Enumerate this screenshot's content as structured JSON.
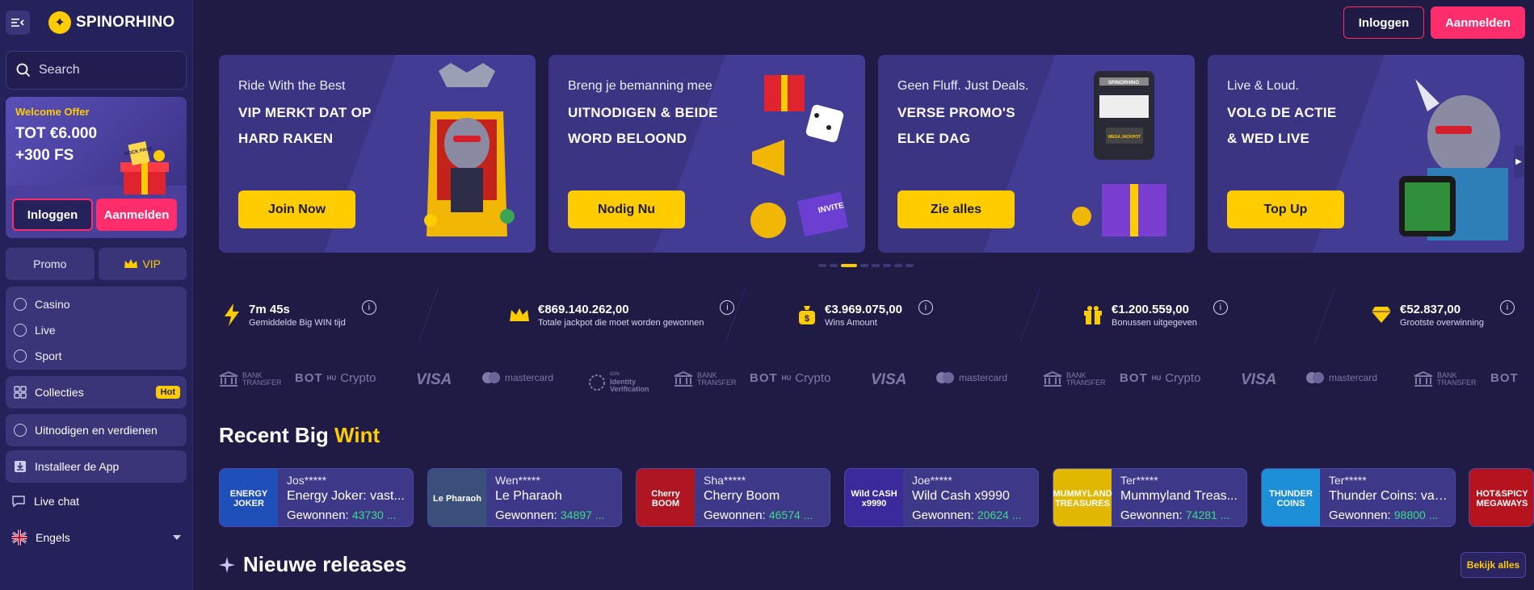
{
  "brand": {
    "name": "SPINORHINO"
  },
  "colors": {
    "background": "#1f1b45",
    "sidebar": "#25215a",
    "accent_yellow": "#ffcc00",
    "accent_pink": "#ff2d6b",
    "win_green": "#3ddc84"
  },
  "sidebar": {
    "search_placeholder": "Search",
    "welcome": {
      "label": "Welcome Offer",
      "title_line1": "TOT €6.000",
      "title_line2": "+300 FS",
      "gift_text": "ROCK PASS",
      "login": "Inloggen",
      "signup": "Aanmelden"
    },
    "promo": "Promo",
    "vip": "VIP",
    "nav": [
      "Casino",
      "Live",
      "Sport"
    ],
    "collections": "Collecties",
    "collections_badge": "Hot",
    "invite": "Uitnodigen en verdienen",
    "install": "Installeer de App",
    "live_chat": "Live chat",
    "language": "Engels"
  },
  "header": {
    "login": "Inloggen",
    "signup": "Aanmelden"
  },
  "banners": [
    {
      "kicker": "Ride With the Best",
      "line1": "VIP MERKT DAT OP",
      "line2": "HARD RAKEN",
      "cta": "Join Now"
    },
    {
      "kicker": "Breng je bemanning mee",
      "line1": "UITNODIGEN & BEIDE",
      "line2": "WORD BELOOND",
      "cta": "Nodig Nu",
      "art_badge": "INVITE"
    },
    {
      "kicker": "Geen Fluff. Just Deals.",
      "line1": "VERSE PROMO'S",
      "line2": "ELKE DAG",
      "cta": "Zie alles",
      "art_text": "SPINORHINO",
      "art_badge": "MEGA JACKPOT"
    },
    {
      "kicker": "Live & Loud.",
      "line1": "VOLG DE ACTIE",
      "line2": "& WED LIVE",
      "cta": "Top Up"
    }
  ],
  "carousel": {
    "total": 8,
    "active_index": 2
  },
  "stats": [
    {
      "value": "7m 45s",
      "label": "Gemiddelde Big WIN tijd",
      "icon": "lightning-icon"
    },
    {
      "value": "€869.140.262,00",
      "label": "Totale jackpot die moet worden gewonnen",
      "icon": "crown-icon"
    },
    {
      "value": "€3.969.075,00",
      "label": "Wins Amount",
      "icon": "money-bag-icon"
    },
    {
      "value": "€1.200.559,00",
      "label": "Bonussen uitgegeven",
      "icon": "gift-icon"
    },
    {
      "value": "€52.837,00",
      "label": "Grootste overwinning",
      "icon": "diamond-icon"
    }
  ],
  "payments": {
    "bank_line1": "BANK",
    "bank_line2": "TRANSFER",
    "crypto_brand": "BOT",
    "crypto_sup": "HU",
    "crypto": "Crypto",
    "visa": "VISA",
    "mastercard": "mastercard",
    "idin_line1": "iDIN",
    "idin_line2": "Identity",
    "idin_line3": "Verification"
  },
  "recent_wins": {
    "title": "Recent Big ",
    "title_accent": "Wint",
    "won_label": "Gewonnen: ",
    "items": [
      {
        "user": "Jos*****",
        "game": "Energy Joker: vast...",
        "amount": "43730 ...",
        "thumb_text": "ENERGY JOKER",
        "thumb_color": "#1f4fb8"
      },
      {
        "user": "Wen*****",
        "game": "Le Pharaoh",
        "amount": "34897 ...",
        "thumb_text": "Le Pharaoh",
        "thumb_color": "#3a4f7a"
      },
      {
        "user": "Sha*****",
        "game": "Cherry Boom",
        "amount": "46574 ...",
        "thumb_text": "Cherry BOOM",
        "thumb_color": "#b01522"
      },
      {
        "user": "Joe*****",
        "game": "Wild Cash x9990",
        "amount": "20624 ...",
        "thumb_text": "Wild CASH x9990",
        "thumb_color": "#3b2a9c"
      },
      {
        "user": "Ter*****",
        "game": "Mummyland Treas...",
        "amount": "74281 ...",
        "thumb_text": "MUMMYLAND TREASURES",
        "thumb_color": "#e0b800"
      },
      {
        "user": "Ter*****",
        "game": "Thunder Coins: vas...",
        "amount": "98800 ...",
        "thumb_text": "THUNDER COINS",
        "thumb_color": "#1c8fd6"
      }
    ],
    "partial_thumb_text": "HOT&SPICY MEGAWAYS"
  },
  "new_releases": {
    "title": "Nieuwe releases",
    "see_all": "Bekijk alles"
  }
}
